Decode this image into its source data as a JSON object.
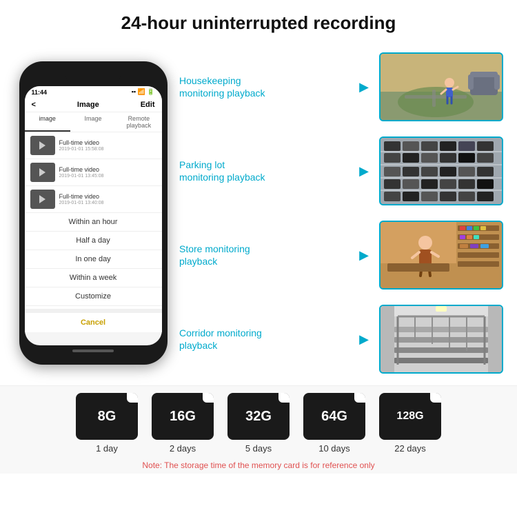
{
  "header": {
    "title": "24-hour uninterrupted recording"
  },
  "phone": {
    "time": "11:44",
    "screen_title": "Image",
    "edit_label": "Edit",
    "back_label": "<",
    "tabs": [
      "image",
      "Image",
      "Remote playback"
    ],
    "videos": [
      {
        "title": "Full-time video",
        "date": "2019-01-01 15:58:08"
      },
      {
        "title": "Full-time video",
        "date": "2019-01-01 13:45:08"
      },
      {
        "title": "Full-time video",
        "date": "2019-01-01 13:40:08"
      }
    ],
    "dropdown_items": [
      "Within an hour",
      "Half a day",
      "In one day",
      "Within a week",
      "Customize"
    ],
    "cancel_label": "Cancel"
  },
  "monitoring": [
    {
      "label": "Housekeeping\nmonitoring playback",
      "type": "housekeeping"
    },
    {
      "label": "Parking lot\nmonitoring playback",
      "type": "parking"
    },
    {
      "label": "Store monitoring\nplayback",
      "type": "store"
    },
    {
      "label": "Corridor monitoring\nplayback",
      "type": "corridor"
    }
  ],
  "sd_cards": [
    {
      "size": "8G",
      "days": "1 day"
    },
    {
      "size": "16G",
      "days": "2 days"
    },
    {
      "size": "32G",
      "days": "5 days"
    },
    {
      "size": "64G",
      "days": "10 days"
    },
    {
      "size": "128G",
      "days": "22 days"
    }
  ],
  "note": "Note: The storage time of the memory card is for reference only"
}
